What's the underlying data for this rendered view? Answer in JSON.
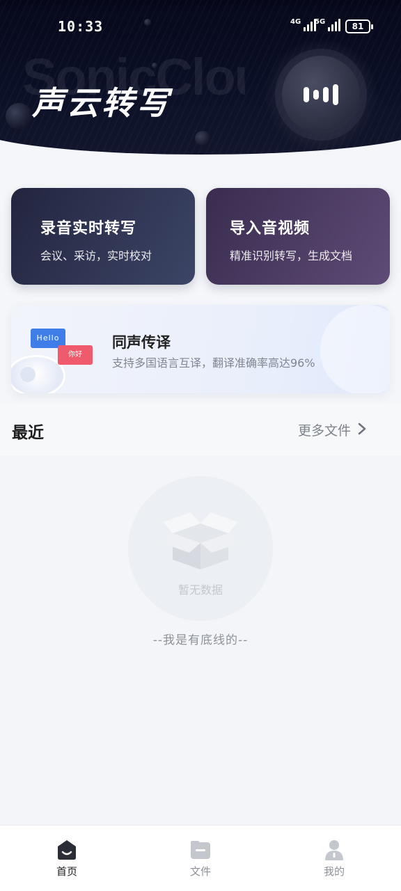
{
  "status_bar": {
    "time": "10:33",
    "network_1": "4G",
    "network_2": "5G",
    "battery": "81"
  },
  "header": {
    "logo_ghost": "SonicCloud",
    "app_title": "声云转写",
    "mic_icon": "voice-wave-icon"
  },
  "cards": {
    "record": {
      "title": "录音实时转写",
      "subtitle": "会议、采访，实时校对"
    },
    "import": {
      "title": "导入音视频",
      "subtitle": "精准识别转写，生成文档"
    }
  },
  "translate": {
    "title": "同声传译",
    "subtitle": "支持多国语言互译，翻译准确率高达96%",
    "bubble_en": "Hello",
    "bubble_zh": "你好"
  },
  "recent": {
    "title": "最近",
    "more_label": "更多文件",
    "empty_text": "暂无数据",
    "bottom_line": "--我是有底线的--"
  },
  "tabs": [
    {
      "label": "首页",
      "icon": "home-icon",
      "active": true
    },
    {
      "label": "文件",
      "icon": "folder-icon",
      "active": false
    },
    {
      "label": "我的",
      "icon": "user-icon",
      "active": false
    }
  ],
  "colors": {
    "header_bg": "#0b1027",
    "record_card": "#2c3150",
    "import_card": "#4a3a63",
    "hello_bubble": "#3f7ee8",
    "nihao_bubble": "#ef5a6c"
  }
}
